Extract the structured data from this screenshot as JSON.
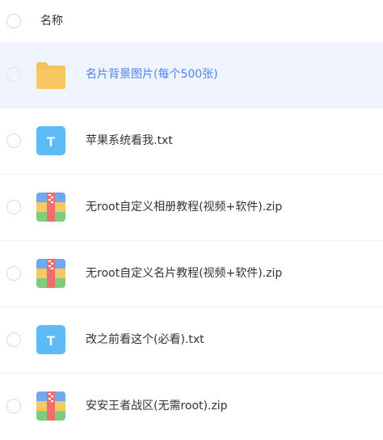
{
  "header": {
    "column_name": "名称"
  },
  "colors": {
    "selected_bg": "#f0f4fe",
    "selected_text": "#4e82f0",
    "divider": "#eef0f4",
    "folder": "#f5c15a",
    "txt_icon": "#5dbaf5",
    "zip_top": "#6fa8ef",
    "zip_mid": "#f4c864",
    "zip_bottom": "#7fcd7c",
    "zip_stripe": "#ef6f6f"
  },
  "files": [
    {
      "name": "名片背景图片(每个500张)",
      "icon": "folder-icon",
      "selected": true
    },
    {
      "name": "苹果系统看我.txt",
      "icon": "txt-file-icon",
      "icon_letter": "T"
    },
    {
      "name": "无root自定义相册教程(视频+软件).zip",
      "icon": "zip-file-icon"
    },
    {
      "name": "无root自定义名片教程(视频+软件).zip",
      "icon": "zip-file-icon"
    },
    {
      "name": "改之前看这个(必看).txt",
      "icon": "txt-file-icon",
      "icon_letter": "T"
    },
    {
      "name": "安安王者战区(无需root).zip",
      "icon": "zip-file-icon"
    }
  ]
}
